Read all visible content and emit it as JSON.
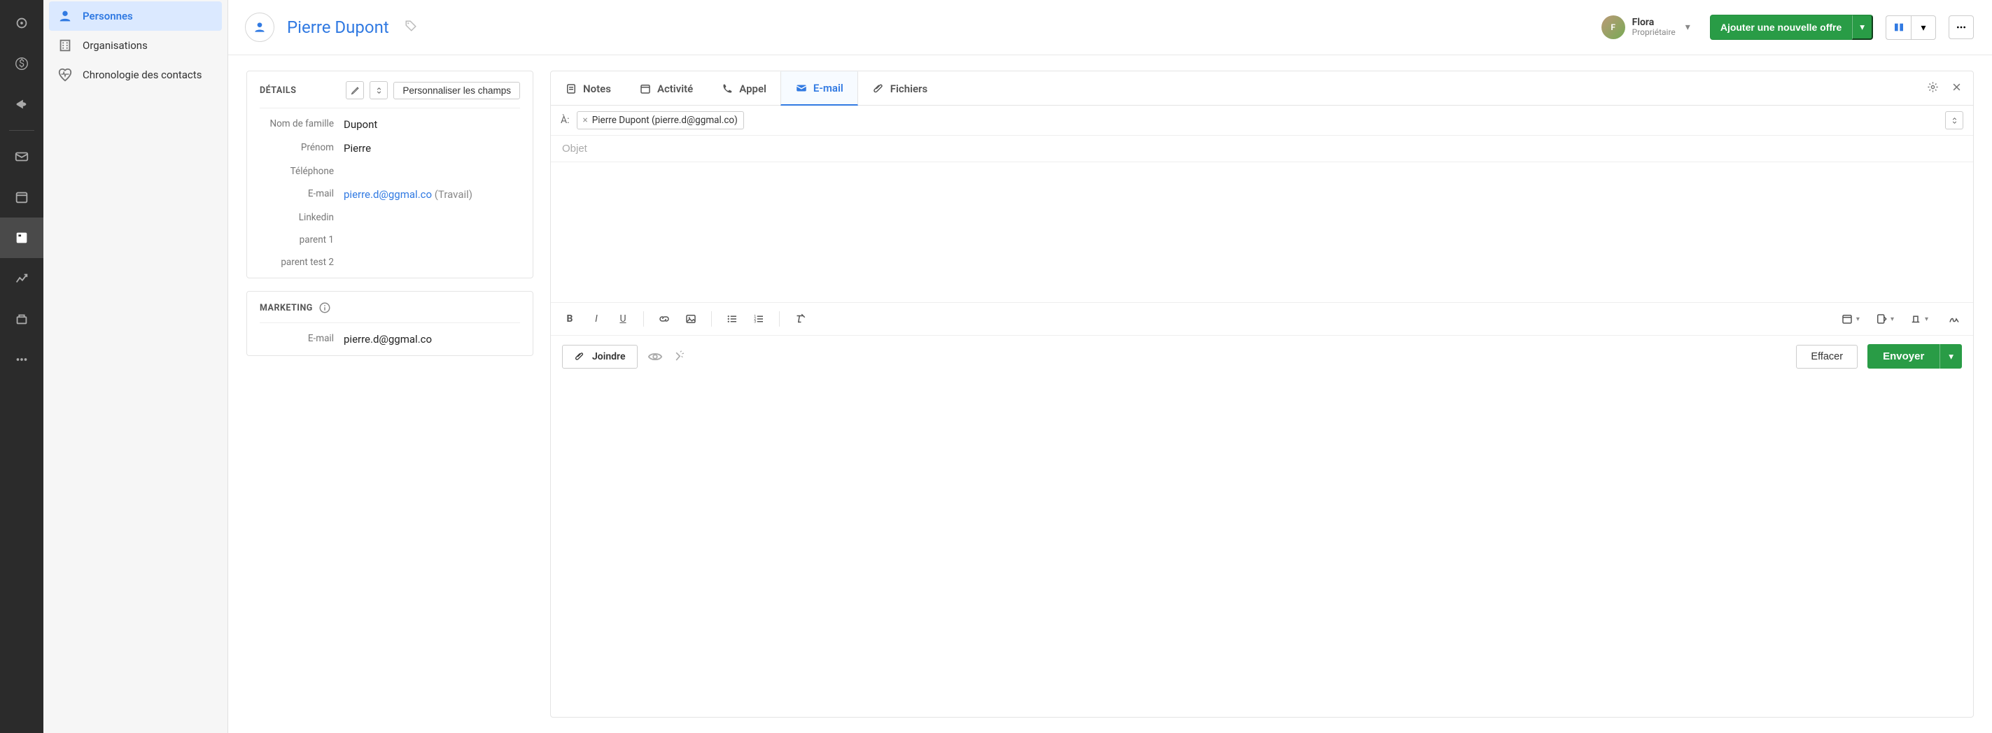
{
  "sidebar": {
    "items": [
      {
        "label": "Personnes",
        "icon": "person-icon"
      },
      {
        "label": "Organisations",
        "icon": "building-icon"
      },
      {
        "label": "Chronologie des contacts",
        "icon": "heartbeat-icon"
      }
    ]
  },
  "person": {
    "name": "Pierre Dupont"
  },
  "owner": {
    "name": "Flora",
    "role": "Propriétaire",
    "initial": "F"
  },
  "header": {
    "add_deal_label": "Ajouter une nouvelle offre"
  },
  "details": {
    "title": "DÉTAILS",
    "customize_label": "Personnaliser les champs",
    "fields": {
      "nom_de_famille": {
        "label": "Nom de famille",
        "value": "Dupont"
      },
      "prenom": {
        "label": "Prénom",
        "value": "Pierre"
      },
      "telephone": {
        "label": "Téléphone",
        "value": ""
      },
      "email": {
        "label": "E-mail",
        "value": "pierre.d@ggmal.co",
        "type": "(Travail)"
      },
      "linkedin": {
        "label": "Linkedin",
        "value": ""
      },
      "parent1": {
        "label": "parent 1",
        "value": ""
      },
      "parent_test_2": {
        "label": "parent test 2",
        "value": ""
      }
    }
  },
  "marketing": {
    "title": "MARKETING",
    "fields": {
      "email": {
        "label": "E-mail",
        "value": "pierre.d@ggmal.co"
      }
    }
  },
  "activity_tabs": {
    "notes": "Notes",
    "activite": "Activité",
    "appel": "Appel",
    "email": "E-mail",
    "fichiers": "Fichiers"
  },
  "email_compose": {
    "to_label": "À:",
    "recipient": "Pierre Dupont (pierre.d@ggmal.co)",
    "subject_placeholder": "Objet",
    "attach_label": "Joindre",
    "clear_label": "Effacer",
    "send_label": "Envoyer"
  }
}
